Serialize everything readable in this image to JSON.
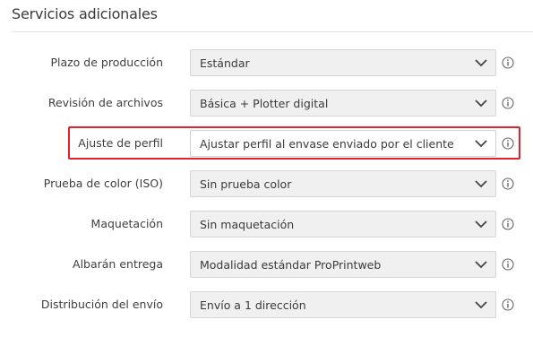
{
  "section": {
    "title": "Servicios adicionales"
  },
  "rows": [
    {
      "label": "Plazo de producción",
      "value": "Estándar"
    },
    {
      "label": "Revisión de archivos",
      "value": "Básica + Plotter digital"
    },
    {
      "label": "Ajuste de perfil",
      "value": "Ajustar perfil al envase enviado por el cliente"
    },
    {
      "label": "Prueba de color (ISO)",
      "value": "Sin prueba color"
    },
    {
      "label": "Maquetación",
      "value": "Sin maquetación"
    },
    {
      "label": "Albarán entrega",
      "value": "Modalidad estándar ProPrintweb"
    },
    {
      "label": "Distribución del envío",
      "value": "Envío a 1 dirección"
    }
  ],
  "highlighted_row": "Ajuste de perfil",
  "icons": {
    "dropdown": "chevron-down-icon",
    "help": "info-icon"
  },
  "colors": {
    "highlight": "#e0242d",
    "select_bg": "#f0f0f0",
    "active_select_bg": "#ffffff"
  }
}
